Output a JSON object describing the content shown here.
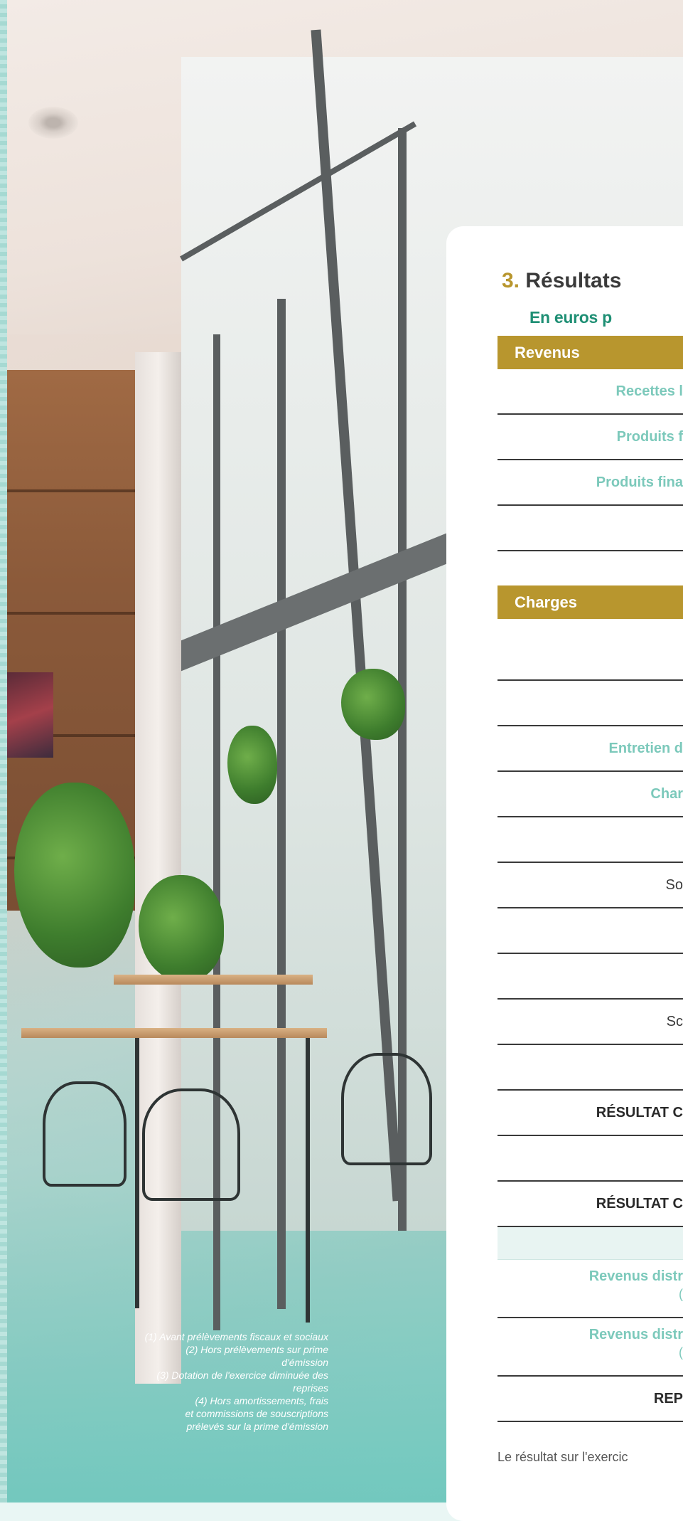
{
  "section": {
    "number": "3.",
    "title": "Résultats",
    "subtitle": "En euros p"
  },
  "revenus": {
    "header": "Revenus",
    "rows": [
      "Recettes l",
      "Produits f",
      "Produits fina",
      ""
    ]
  },
  "charges": {
    "header": "Charges",
    "rows": [
      "",
      "",
      "Entretien d",
      "Char",
      "",
      "So",
      "",
      "",
      "Sc",
      ""
    ]
  },
  "results": {
    "resultat_1": "RÉSULTAT C",
    "blank_1": "",
    "resultat_2": "RÉSULTAT C",
    "tint_blank": "",
    "revenus_distr_1": "Revenus distr",
    "revenus_distr_1_sub": "(",
    "revenus_distr_2": "Revenus distr",
    "revenus_distr_2_sub": "(",
    "report": "REP"
  },
  "footer_text": "Le résultat sur l'exercic",
  "footnotes": [
    "(1) Avant prélèvements fiscaux et sociaux",
    "(2) Hors prélèvements sur prime",
    "d'émission",
    "(3) Dotation de l'exercice diminuée des",
    "reprises",
    "(4) Hors amortissements, frais",
    "et commissions de souscriptions",
    "prélevés sur la prime d'émission"
  ],
  "colors": {
    "gold": "#b8962e",
    "teal": "#1e8f74",
    "light_teal": "#7cc9bb"
  }
}
